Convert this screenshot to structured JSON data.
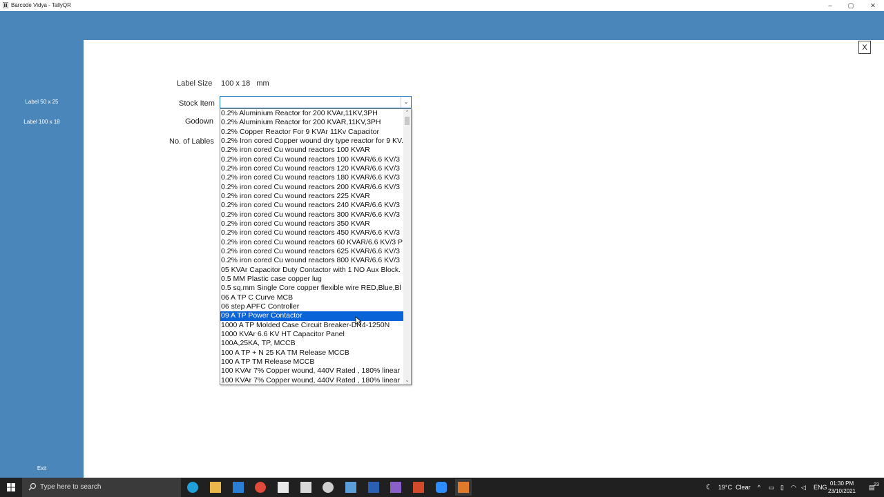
{
  "window": {
    "title": "Barcode Vidya - TallyQR",
    "minimize": "–",
    "maximize": "▢",
    "close": "✕"
  },
  "sidebar": {
    "items": [
      {
        "label": "Label 50 x 25"
      },
      {
        "label": "Label 100 x 18"
      }
    ],
    "exit": "Exit"
  },
  "dialog": {
    "close_label": "X"
  },
  "form": {
    "label_size_label": "Label Size",
    "label_size_value": "100 x 18   mm",
    "stock_item_label": "Stock Item",
    "stock_item_value": "",
    "godown_label": "Godown",
    "no_of_labels_label": "No. of Lables"
  },
  "dropdown": {
    "items": [
      "0.2% Aluminium Reactor for 200 KVAr,11KV,3PH",
      "0.2% Aluminium Reactor for 200 KVAR,11KV,3PH",
      "0.2% Copper Reactor For 9 KVAr 11Kv Capacitor",
      "0.2% Iron cored Copper wound dry type reactor for 9 KV.",
      "0.2% iron cored Cu wound reactors 100 KVAR",
      "0.2% iron cored Cu wound reactors 100 KVAR/6.6 KV/3",
      "0.2% iron cored Cu wound reactors 120 KVAR/6.6 KV/3",
      "0.2% iron cored Cu wound reactors 180 KVAR/6.6 KV/3",
      "0.2% iron cored Cu wound reactors  200 KVAR/6.6 KV/3",
      "0.2% iron cored Cu wound reactors 225 KVAR",
      "0.2% iron cored Cu wound reactors 240 KVAR/6.6 KV/3",
      "0.2% iron cored Cu wound reactors 300 KVAR/6.6 KV/3",
      "0.2% iron cored Cu wound reactors 350 KVAR",
      "0.2% iron cored Cu wound reactors 450 KVAR/6.6 KV/3",
      "0.2% iron cored Cu wound reactors 60 KVAR/6.6 KV/3 P",
      "0.2% iron cored Cu wound reactors 625 KVAR/6.6 KV/3",
      "0.2% iron cored Cu wound reactors 800 KVAR/6.6 KV/3",
      "05 KVAr Capacitor Duty Contactor with 1 NO Aux Block.",
      "0.5 MM Plastic case copper lug",
      "0.5 sq.mm Single Core copper flexible wire  RED,Blue,Bl",
      "06 A TP C Curve MCB",
      "06  step APFC Controller",
      "09 A TP Power Contactor",
      "1000 A TP Molded Case Circuit Breaker-DN4-1250N",
      "1000 KVAr  6.6 KV HT Capacitor Panel",
      "100A,25KA, TP, MCCB",
      "100 A TP + N 25 KA TM Release MCCB",
      "100 A TP TM Release MCCB",
      "100 KVAr 7% Copper wound, 440V Rated , 180% linear",
      "100 KVAr 7% Copper wound, 440V Rated , 180% linear"
    ],
    "selected_index": 22
  },
  "taskbar": {
    "search_placeholder": "Type here to search",
    "weather": "19°C  Clear",
    "language": "ENG",
    "time": "01:30 PM",
    "date": "23/10/2021",
    "notifications": "23"
  }
}
